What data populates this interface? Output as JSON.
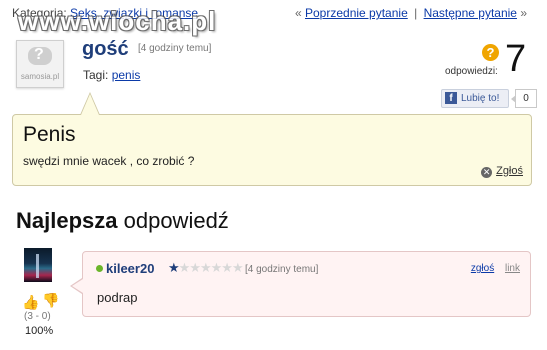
{
  "topbar": {
    "category_label": "Kategoria:",
    "category_link": "Seks, związki i romanse",
    "prev_quote": "«",
    "prev_label": "Poprzednie pytanie",
    "separator": "|",
    "next_label": "Następne pytanie",
    "next_quote": "»"
  },
  "watermark": {
    "text": "www.wiocha.pl"
  },
  "avatar": {
    "brand": "samosia.pl",
    "symbol": "?"
  },
  "question": {
    "author": "gość",
    "time": "[4 godziny temu]",
    "tags_label": "Tagi:",
    "tag": "penis",
    "title": "Penis",
    "body": "swędzi mnie wacek , co zrobić ?",
    "report_label": "Zgłoś"
  },
  "answers": {
    "icon": "?",
    "label": "odpowiedzi:",
    "count": "7"
  },
  "like": {
    "fb_letter": "f",
    "label": "Lubię to!",
    "count": "0"
  },
  "best": {
    "bold": "Najlepsza",
    "rest": " odpowiedź"
  },
  "answer": {
    "author": "kileer20",
    "rating_stars": 1,
    "max_stars": 7,
    "time": "[4 godziny temu]",
    "report_label": "zgłoś",
    "link_label": "link",
    "body": "podrap",
    "votes": "(3 - 0)",
    "percent": "100%"
  },
  "colors": {
    "link": "#0b3aa8",
    "question_bg": "#fdfbe1",
    "answer_bg": "#fff3f3",
    "name": "#1f3e7a"
  }
}
